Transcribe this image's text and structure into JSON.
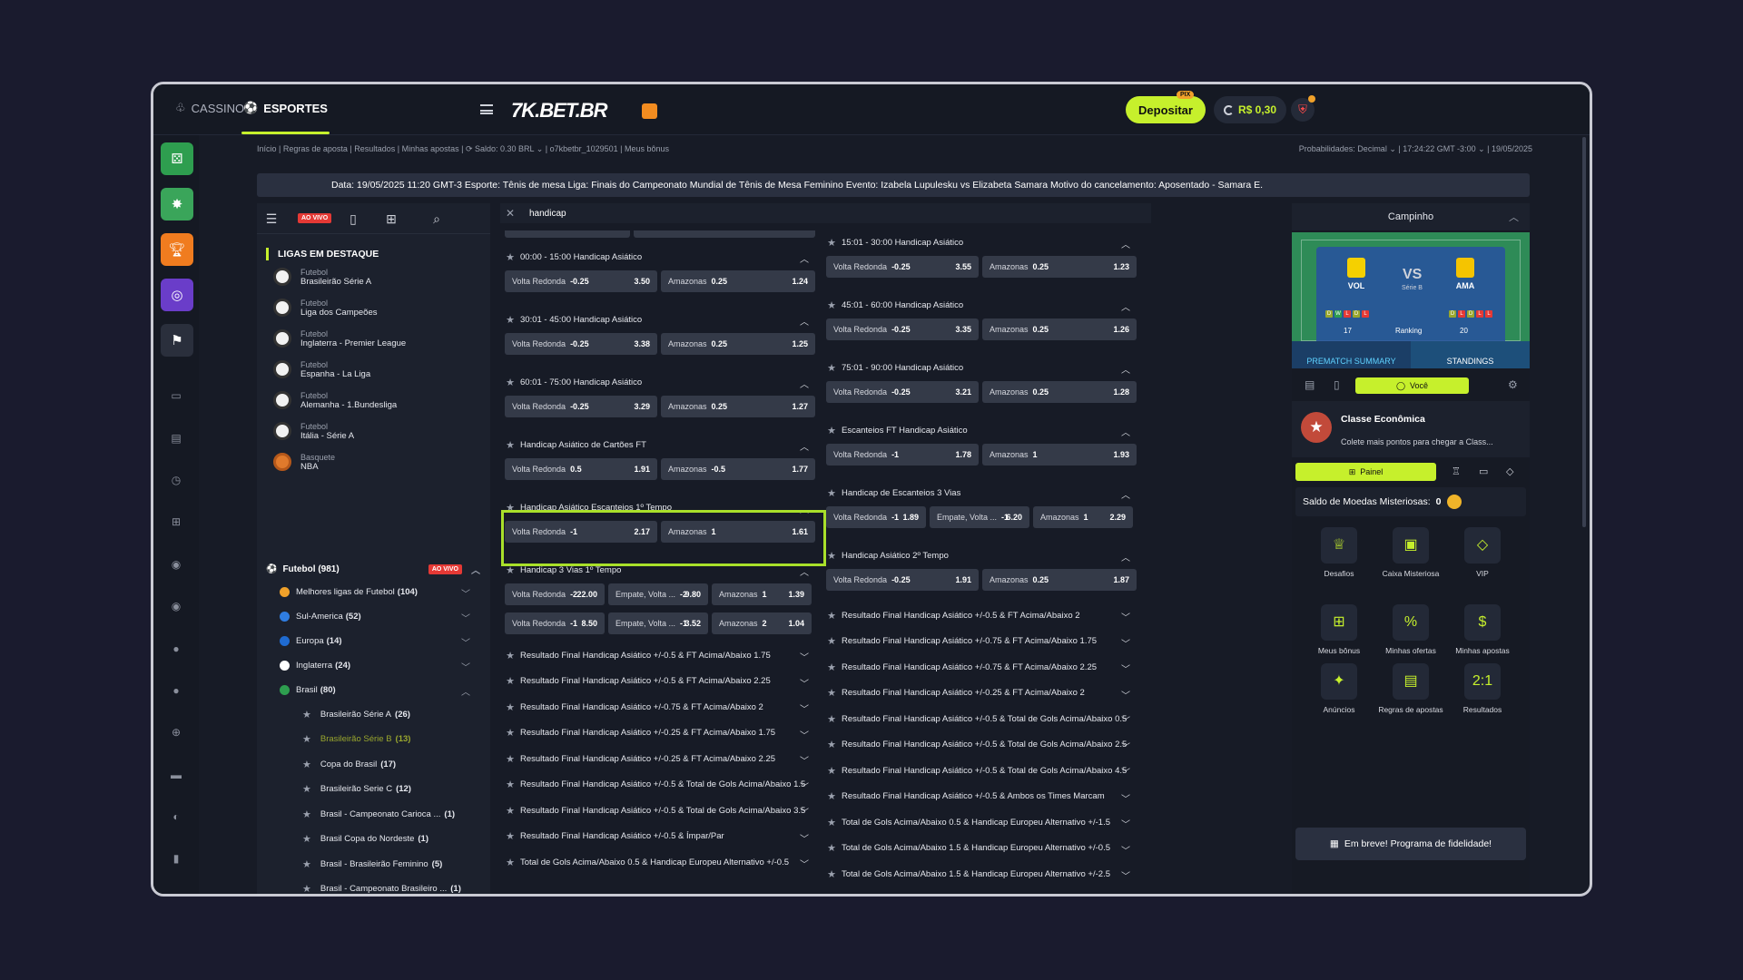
{
  "header": {
    "tabs": [
      {
        "label": "CASSINO"
      },
      {
        "label": "ESPORTES"
      }
    ],
    "logo": "7K.BET.BR",
    "deposit_label": "Depositar",
    "pix_badge": "PIX",
    "balance": "R$ 0,30"
  },
  "breadcrumb": {
    "left": "Início | Regras de aposta | Resultados | Minhas apostas | ⟳ Saldo: 0.30 BRL ⌄ | o7kbetbr_1029501 | Meus bônus",
    "right": "Probabilidades: Decimal ⌄ | 17:24:22 GMT -3:00 ⌄ | 19/05/2025"
  },
  "ticker": "Data: 19/05/2025 11:20 GMT-3 Esporte: Tênis de mesa Liga: Finais do Campeonato Mundial de Tênis de Mesa Feminino Evento: Izabela Lupulesku vs Elizabeta Samara Motivo do cancelamento: Aposentado - Samara E.",
  "left_panel": {
    "live_badge": "AO VIVO",
    "featured_title": "LIGAS EM DESTAQUE",
    "featured": [
      {
        "sport": "Futebol",
        "name": "Brasileirão Série A"
      },
      {
        "sport": "Futebol",
        "name": "Liga dos Campeões"
      },
      {
        "sport": "Futebol",
        "name": "Inglaterra - Premier League"
      },
      {
        "sport": "Futebol",
        "name": "Espanha - La Liga"
      },
      {
        "sport": "Futebol",
        "name": "Alemanha - 1.Bundesliga"
      },
      {
        "sport": "Futebol",
        "name": "Itália - Série A"
      },
      {
        "sport": "Basquete",
        "name": "NBA"
      }
    ],
    "sport_head": "Futebol (981)",
    "tree": [
      {
        "label": "Melhores ligas de Futebol",
        "count": "(104)"
      },
      {
        "label": "Sul-America",
        "count": "(52)"
      },
      {
        "label": "Europa",
        "count": "(14)"
      },
      {
        "label": "Inglaterra",
        "count": "(24)"
      },
      {
        "label": "Brasil",
        "count": "(80)"
      }
    ],
    "sub": [
      {
        "label": "Brasileirão Série A",
        "count": "(26)"
      },
      {
        "label": "Brasileirão Série B",
        "count": "(13)"
      },
      {
        "label": "Copa do Brasil",
        "count": "(17)"
      },
      {
        "label": "Brasileirão Serie C",
        "count": "(12)"
      },
      {
        "label": "Brasil - Campeonato Carioca ...",
        "count": "(1)"
      },
      {
        "label": "Brasil Copa do Nordeste",
        "count": "(1)"
      },
      {
        "label": "Brasil - Brasileirão Feminino",
        "count": "(5)"
      },
      {
        "label": "Brasil - Campeonato Brasileiro ...",
        "count": "(1)"
      }
    ]
  },
  "search": {
    "query": "handicap"
  },
  "markets_left": [
    {
      "title": "00:00 - 15:00 Handicap Asiático",
      "odds": [
        [
          "Volta Redonda",
          "-0.25",
          "3.50"
        ],
        [
          "Amazonas",
          "0.25",
          "1.24"
        ]
      ]
    },
    {
      "title": "30:01 - 45:00 Handicap Asiático",
      "odds": [
        [
          "Volta Redonda",
          "-0.25",
          "3.38"
        ],
        [
          "Amazonas",
          "0.25",
          "1.25"
        ]
      ]
    },
    {
      "title": "60:01 - 75:00 Handicap Asiático",
      "odds": [
        [
          "Volta Redonda",
          "-0.25",
          "3.29"
        ],
        [
          "Amazonas",
          "0.25",
          "1.27"
        ]
      ]
    },
    {
      "title": "Handicap Asiático de Cartões FT",
      "odds": [
        [
          "Volta Redonda",
          "0.5",
          "1.91"
        ],
        [
          "Amazonas",
          "-0.5",
          "1.77"
        ]
      ]
    },
    {
      "title": "Handicap Asiático Escanteios 1º Tempo",
      "odds": [
        [
          "Volta Redonda",
          "-1",
          "2.17"
        ],
        [
          "Amazonas",
          "1",
          "1.61"
        ]
      ]
    },
    {
      "title": "Handicap 3 Vias 1º Tempo",
      "rows": [
        [
          [
            "Volta Redonda",
            "-2",
            "22.00"
          ],
          [
            "Empate, Volta ...",
            "-2",
            "9.80"
          ],
          [
            "Amazonas",
            "1",
            "1.39"
          ]
        ],
        [
          [
            "Volta Redonda",
            "-1",
            "8.50"
          ],
          [
            "Empate, Volta ...",
            "-1",
            "3.52"
          ],
          [
            "Amazonas",
            "2",
            "1.04"
          ]
        ]
      ]
    }
  ],
  "collapsed_left": [
    "Resultado Final Handicap Asiático +/-0.5 & FT Acima/Abaixo 1.75",
    "Resultado Final Handicap Asiático +/-0.5 & FT Acima/Abaixo 2.25",
    "Resultado Final Handicap Asiático +/-0.75 & FT Acima/Abaixo 2",
    "Resultado Final Handicap Asiático +/-0.25 & FT Acima/Abaixo 1.75",
    "Resultado Final Handicap Asiático +/-0.25 & FT Acima/Abaixo 2.25",
    "Resultado Final Handicap Asiático +/-0.5 & Total de Gols Acima/Abaixo 1.5",
    "Resultado Final Handicap Asiático +/-0.5 & Total de Gols Acima/Abaixo 3.5",
    "Resultado Final Handicap Asiático +/-0.5 & Ímpar/Par",
    "Total de Gols Acima/Abaixo 0.5 & Handicap Europeu Alternativo +/-0.5"
  ],
  "markets_right": [
    {
      "title": "15:01 - 30:00 Handicap Asiático",
      "odds": [
        [
          "Volta Redonda",
          "-0.25",
          "3.55"
        ],
        [
          "Amazonas",
          "0.25",
          "1.23"
        ]
      ]
    },
    {
      "title": "45:01 - 60:00 Handicap Asiático",
      "odds": [
        [
          "Volta Redonda",
          "-0.25",
          "3.35"
        ],
        [
          "Amazonas",
          "0.25",
          "1.26"
        ]
      ]
    },
    {
      "title": "75:01 - 90:00 Handicap Asiático",
      "odds": [
        [
          "Volta Redonda",
          "-0.25",
          "3.21"
        ],
        [
          "Amazonas",
          "0.25",
          "1.28"
        ]
      ]
    },
    {
      "title": "Escanteios FT Handicap Asiático",
      "odds": [
        [
          "Volta Redonda",
          "-1",
          "1.78"
        ],
        [
          "Amazonas",
          "1",
          "1.93"
        ]
      ]
    },
    {
      "title": "Handicap de Escanteios 3 Vias",
      "odds3": [
        [
          "Volta Redonda",
          "-1",
          "1.89"
        ],
        [
          "Empate, Volta ...",
          "-1",
          "6.20"
        ],
        [
          "Amazonas",
          "1",
          "2.29"
        ]
      ]
    },
    {
      "title": "Handicap Asiático 2º Tempo",
      "odds": [
        [
          "Volta Redonda",
          "-0.25",
          "1.91"
        ],
        [
          "Amazonas",
          "0.25",
          "1.87"
        ]
      ]
    }
  ],
  "collapsed_right": [
    "Resultado Final Handicap Asiático +/-0.5 & FT Acima/Abaixo 2",
    "Resultado Final Handicap Asiático +/-0.75 & FT Acima/Abaixo 1.75",
    "Resultado Final Handicap Asiático +/-0.75 & FT Acima/Abaixo 2.25",
    "Resultado Final Handicap Asiático +/-0.25 & FT Acima/Abaixo 2",
    "Resultado Final Handicap Asiático +/-0.5 & Total de Gols Acima/Abaixo 0.5",
    "Resultado Final Handicap Asiático +/-0.5 & Total de Gols Acima/Abaixo 2.5",
    "Resultado Final Handicap Asiático +/-0.5 & Total de Gols Acima/Abaixo 4.5",
    "Resultado Final Handicap Asiático +/-0.5 & Ambos os Times Marcam",
    "Total de Gols Acima/Abaixo 0.5 & Handicap Europeu Alternativo +/-1.5",
    "Total de Gols Acima/Abaixo 1.5 & Handicap Europeu Alternativo +/-0.5",
    "Total de Gols Acima/Abaixo 1.5 & Handicap Europeu Alternativo +/-2.5"
  ],
  "right_panel": {
    "title": "Campinho",
    "home": "VOL",
    "away": "AMA",
    "vs": "VS",
    "league": "Série B",
    "home_form": [
      "D",
      "W",
      "L",
      "D",
      "L"
    ],
    "away_form": [
      "D",
      "L",
      "D",
      "L",
      "L"
    ],
    "home_rank": "17",
    "away_rank": "20",
    "rank_label": "Ranking",
    "tab_summary": "PREMATCH SUMMARY",
    "tab_standings": "STANDINGS",
    "voce": "Você",
    "classe_title": "Classe Econômica",
    "classe_desc": "Colete mais pontos para chegar a Class...",
    "painel": "Painel",
    "coins_label": "Saldo de Moedas Misteriosas:",
    "coins_value": "0",
    "grid": [
      {
        "label": "Desafios",
        "icon": "trophy-icon"
      },
      {
        "label": "Caixa Misteriosa",
        "icon": "box-icon"
      },
      {
        "label": "VIP",
        "icon": "diamond-icon"
      },
      {
        "label": "Meus bônus",
        "icon": "gift-icon"
      },
      {
        "label": "Minhas ofertas",
        "icon": "percent-icon"
      },
      {
        "label": "Minhas apostas",
        "icon": "ticket-icon"
      },
      {
        "label": "Anúncios",
        "icon": "megaphone-icon"
      },
      {
        "label": "Regras de apostas",
        "icon": "rules-icon"
      },
      {
        "label": "Resultados",
        "icon": "score-icon"
      }
    ],
    "score_glyph": "2:1",
    "loyalty": "Em breve! Programa de fidelidade!"
  },
  "colors": {
    "accent": "#c6f02c",
    "live": "#e53935",
    "highlight": "#a9e02a"
  }
}
